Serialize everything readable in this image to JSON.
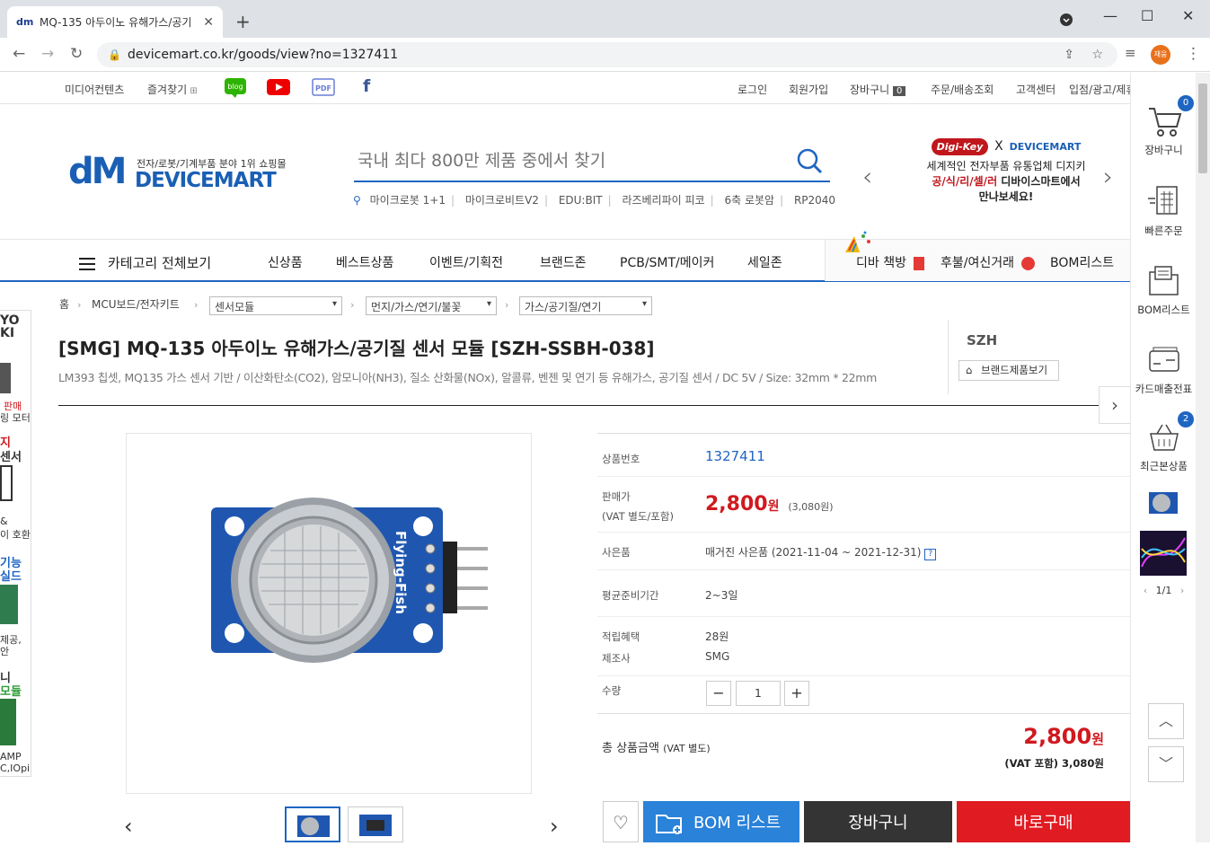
{
  "browser": {
    "tab_title": "MQ-135 아두이노 유해가스/공기",
    "tab_favicon": "dm",
    "url": "devicemart.co.kr/goods/view?no=1327411",
    "profile_label": "재웅"
  },
  "utility_bar": {
    "left": [
      "미디어컨텐츠",
      "즐겨찾기"
    ],
    "social": [
      "blog",
      "youtube",
      "PDF",
      "facebook"
    ],
    "right": [
      "로그인",
      "회원가입",
      "장바구니",
      "주문/배송조회",
      "고객센터",
      "입점/광고/제휴"
    ],
    "cart_count": "0"
  },
  "header": {
    "logo_mark": "dM",
    "logo_tagline": "전자/로봇/기계부품 분야 1위 쇼핑몰",
    "logo_name": "DEVICEMART",
    "search_placeholder": "국내 최다 800만 제품 중에서 찾기",
    "keywords": [
      "마이크로봇 1+1",
      "마이크로비트V2",
      "EDU:BIT",
      "라즈베리파이 피코",
      "6축 로봇암",
      "RP2040"
    ],
    "promo": {
      "digikey": "Digi-Key",
      "x": "X",
      "dm": "DEVICEMART",
      "line1": "세계적인 전자부품 유통업체 디지키",
      "line2_red": "공/식/리/셀/러",
      "line2_rest": " 디바이스마트에서",
      "line3": "만나보세요!"
    }
  },
  "gnb": {
    "category_all": "카테고리 전체보기",
    "items": [
      "신상품",
      "베스트상품",
      "이벤트/기획전",
      "브랜드존",
      "PCB/SMT/메이커",
      "세일존"
    ],
    "right_items": [
      "디바 책방",
      "후불/여신거래",
      "BOM리스트"
    ]
  },
  "breadcrumb": {
    "home": "홈",
    "level1": "MCU보드/전자키트",
    "level2": "센서모듈",
    "level3": "먼지/가스/연기/불꽃",
    "level4": "가스/공기질/연기"
  },
  "product": {
    "title": "[SMG] MQ-135 아두이노 유해가스/공기질 센서 모듈 [SZH-SSBH-038]",
    "subtitle": "LM393 칩셋, MQ135 가스 센서 기반 / 이산화탄소(CO2), 암모니아(NH3), 질소 산화물(NOx), 알콜류, 벤젠 및 연기 등 유해가스, 공기질 센서 / DC 5V / Size: 32mm * 22mm",
    "brand": "SZH",
    "brand_button": "브랜드제품보기",
    "board_label": "Flying-Fish",
    "info": {
      "code_label": "상품번호",
      "code": "1327411",
      "price_label": "판매가",
      "price_label2": "(VAT 별도/포함)",
      "price": "2,800",
      "price_unit": "원",
      "price_vat": "(3,080원)",
      "gift_label": "사은품",
      "gift": "매거진 사은품 (2021-11-04 ~ 2021-12-31)",
      "prep_label": "평균준비기간",
      "prep": "2~3일",
      "points_label": "적립혜택",
      "points": "28원",
      "maker_label": "제조사",
      "maker": "SMG",
      "qty_label": "수량",
      "qty": "1",
      "minus": "−",
      "plus": "+"
    },
    "total": {
      "label": "총 상품금액",
      "label_small": "(VAT 별도)",
      "value": "2,800",
      "unit": "원",
      "vat": "(VAT 포함) 3,080원"
    },
    "buttons": {
      "bom": "BOM 리스트",
      "cart": "장바구니",
      "buy": "바로구매"
    }
  },
  "quick_menu": {
    "cart": "장바구니",
    "cart_count": "0",
    "fast_order": "빠른주문",
    "bom": "BOM리스트",
    "card_receipt": "카드매출전표",
    "recent": "최근본상품",
    "recent_count": "2",
    "pager": "1/1"
  },
  "left_banner": [
    "YO",
    "KI",
    "판매",
    "링 모터",
    "지",
    "센서",
    "&",
    "이 호환",
    "기능",
    "실드",
    "제공,",
    "안",
    "니",
    "모듈",
    "AMP",
    "C,IOpin"
  ],
  "colors": {
    "brand_blue": "#1f65c2",
    "price_red": "#d0191f",
    "buy_red": "#e01b22",
    "cart_dark": "#343434",
    "bom_blue": "#2a82d9"
  }
}
